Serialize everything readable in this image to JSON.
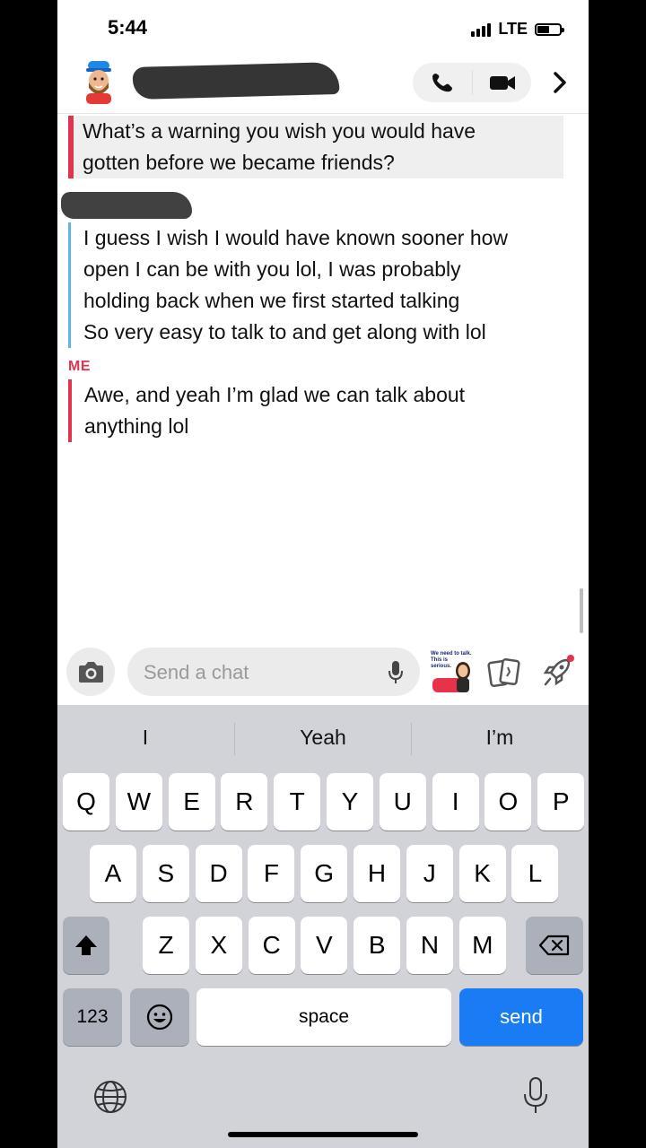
{
  "status_bar": {
    "time": "5:44",
    "network": "LTE"
  },
  "messages": {
    "quoted_prompt": {
      "lines": [
        "What’s a warning you wish you would have",
        "gotten before we became friends?"
      ]
    },
    "friend_reply": {
      "lines": [
        "I guess I wish I would have known sooner how",
        "open I can be with you lol, I was probably",
        "holding back when we first started talking",
        "So very easy to talk to and get along with lol"
      ]
    },
    "me_label": "ME",
    "my_reply": {
      "lines": [
        "Awe, and yeah I’m glad we can talk about",
        "anything lol"
      ]
    }
  },
  "chat_input": {
    "placeholder": "Send a chat"
  },
  "sticker": {
    "text_lines": [
      "We need to talk.",
      "This is",
      "serious."
    ]
  },
  "keyboard": {
    "suggestions": [
      "I",
      "Yeah",
      "I’m"
    ],
    "row1": [
      "Q",
      "W",
      "E",
      "R",
      "T",
      "Y",
      "U",
      "I",
      "O",
      "P"
    ],
    "row2": [
      "A",
      "S",
      "D",
      "F",
      "G",
      "H",
      "J",
      "K",
      "L"
    ],
    "row3": [
      "Z",
      "X",
      "C",
      "V",
      "B",
      "N",
      "M"
    ],
    "numbers_key": "123",
    "space_key": "space",
    "send_key": "send"
  },
  "colors": {
    "accent_red": "#e2334f",
    "friend_blue": "#5bb8e6",
    "send_blue": "#1a7cf5"
  },
  "icons": [
    "phone-icon",
    "video-icon",
    "chevron-right-icon",
    "camera-icon",
    "microphone-icon",
    "cards-icon",
    "rocket-icon",
    "shift-icon",
    "backspace-icon",
    "emoji-icon",
    "globe-icon"
  ]
}
